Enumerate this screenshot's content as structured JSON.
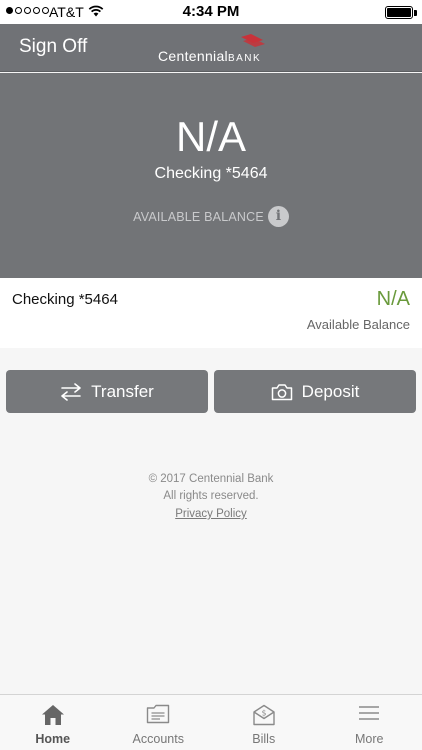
{
  "status_bar": {
    "carrier": "AT&T",
    "time": "4:34 PM",
    "signal_bars_filled": 1,
    "signal_bars_total": 5
  },
  "header": {
    "sign_off_label": "Sign Off",
    "logo_text": "Centennial",
    "logo_text_suffix": "BANK"
  },
  "hero": {
    "balance": "N/A",
    "account_name": "Checking *5464",
    "available_label": "AVAILABLE BALANCE"
  },
  "account_row": {
    "name": "Checking *5464",
    "amount": "N/A",
    "amount_label": "Available Balance"
  },
  "actions": {
    "transfer_label": "Transfer",
    "transfer_icon": "transfer-arrows-icon",
    "deposit_label": "Deposit",
    "deposit_icon": "camera-icon"
  },
  "footer": {
    "copyright": "© 2017 Centennial Bank",
    "rights": "All rights reserved.",
    "privacy_link": "Privacy Policy"
  },
  "tabs": [
    {
      "label": "Home",
      "icon": "home-icon",
      "active": true
    },
    {
      "label": "Accounts",
      "icon": "accounts-icon",
      "active": false
    },
    {
      "label": "Bills",
      "icon": "bills-icon",
      "active": false
    },
    {
      "label": "More",
      "icon": "menu-icon",
      "active": false
    }
  ],
  "colors": {
    "header_gray": "#707276",
    "hero_gray": "#727477",
    "button_gray": "#76787b",
    "balance_green": "#6a9a3c",
    "logo_red": "#c8323a"
  }
}
